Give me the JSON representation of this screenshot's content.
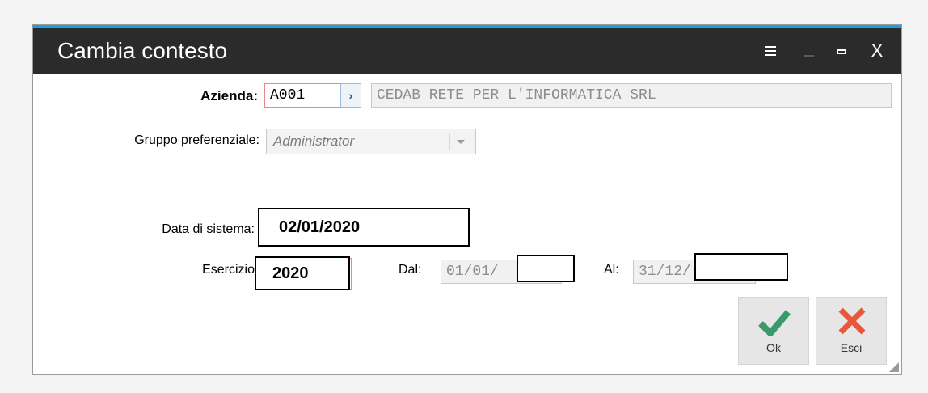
{
  "window": {
    "title": "Cambia contesto",
    "close_glyph": "X"
  },
  "azienda": {
    "label": "Azienda:",
    "code": "A001",
    "zoom_glyph": "›",
    "name": "CEDAB RETE PER L'INFORMATICA SRL"
  },
  "gruppo": {
    "label": "Gruppo preferenziale:",
    "value": "Administrator"
  },
  "data_sistema": {
    "label": "Data di sistema:",
    "value": "02/01/2020"
  },
  "esercizio": {
    "label": "Esercizio",
    "value": "2020",
    "dal_label": "Dal:",
    "dal_value": "01/01/",
    "al_label": "Al:",
    "al_value": "31/12/"
  },
  "buttons": {
    "ok_key": "O",
    "ok_rest": "k",
    "esci_key": "E",
    "esci_rest": "sci"
  },
  "colors": {
    "accent": "#1ba1e2",
    "titlebar": "#2b2b2b",
    "ok_green": "#3a9a6a",
    "esci_red": "#e8573b",
    "required_border": "#e58a8a"
  },
  "icons": {
    "menu": "hamburger-icon",
    "minimize": "minimize-icon",
    "maximize": "maximize-icon",
    "close": "close-icon",
    "ok": "checkmark-icon",
    "esci": "x-icon",
    "dropdown": "chevron-down-icon",
    "zoom": "chevron-right-icon",
    "resize": "resize-grip-icon"
  }
}
